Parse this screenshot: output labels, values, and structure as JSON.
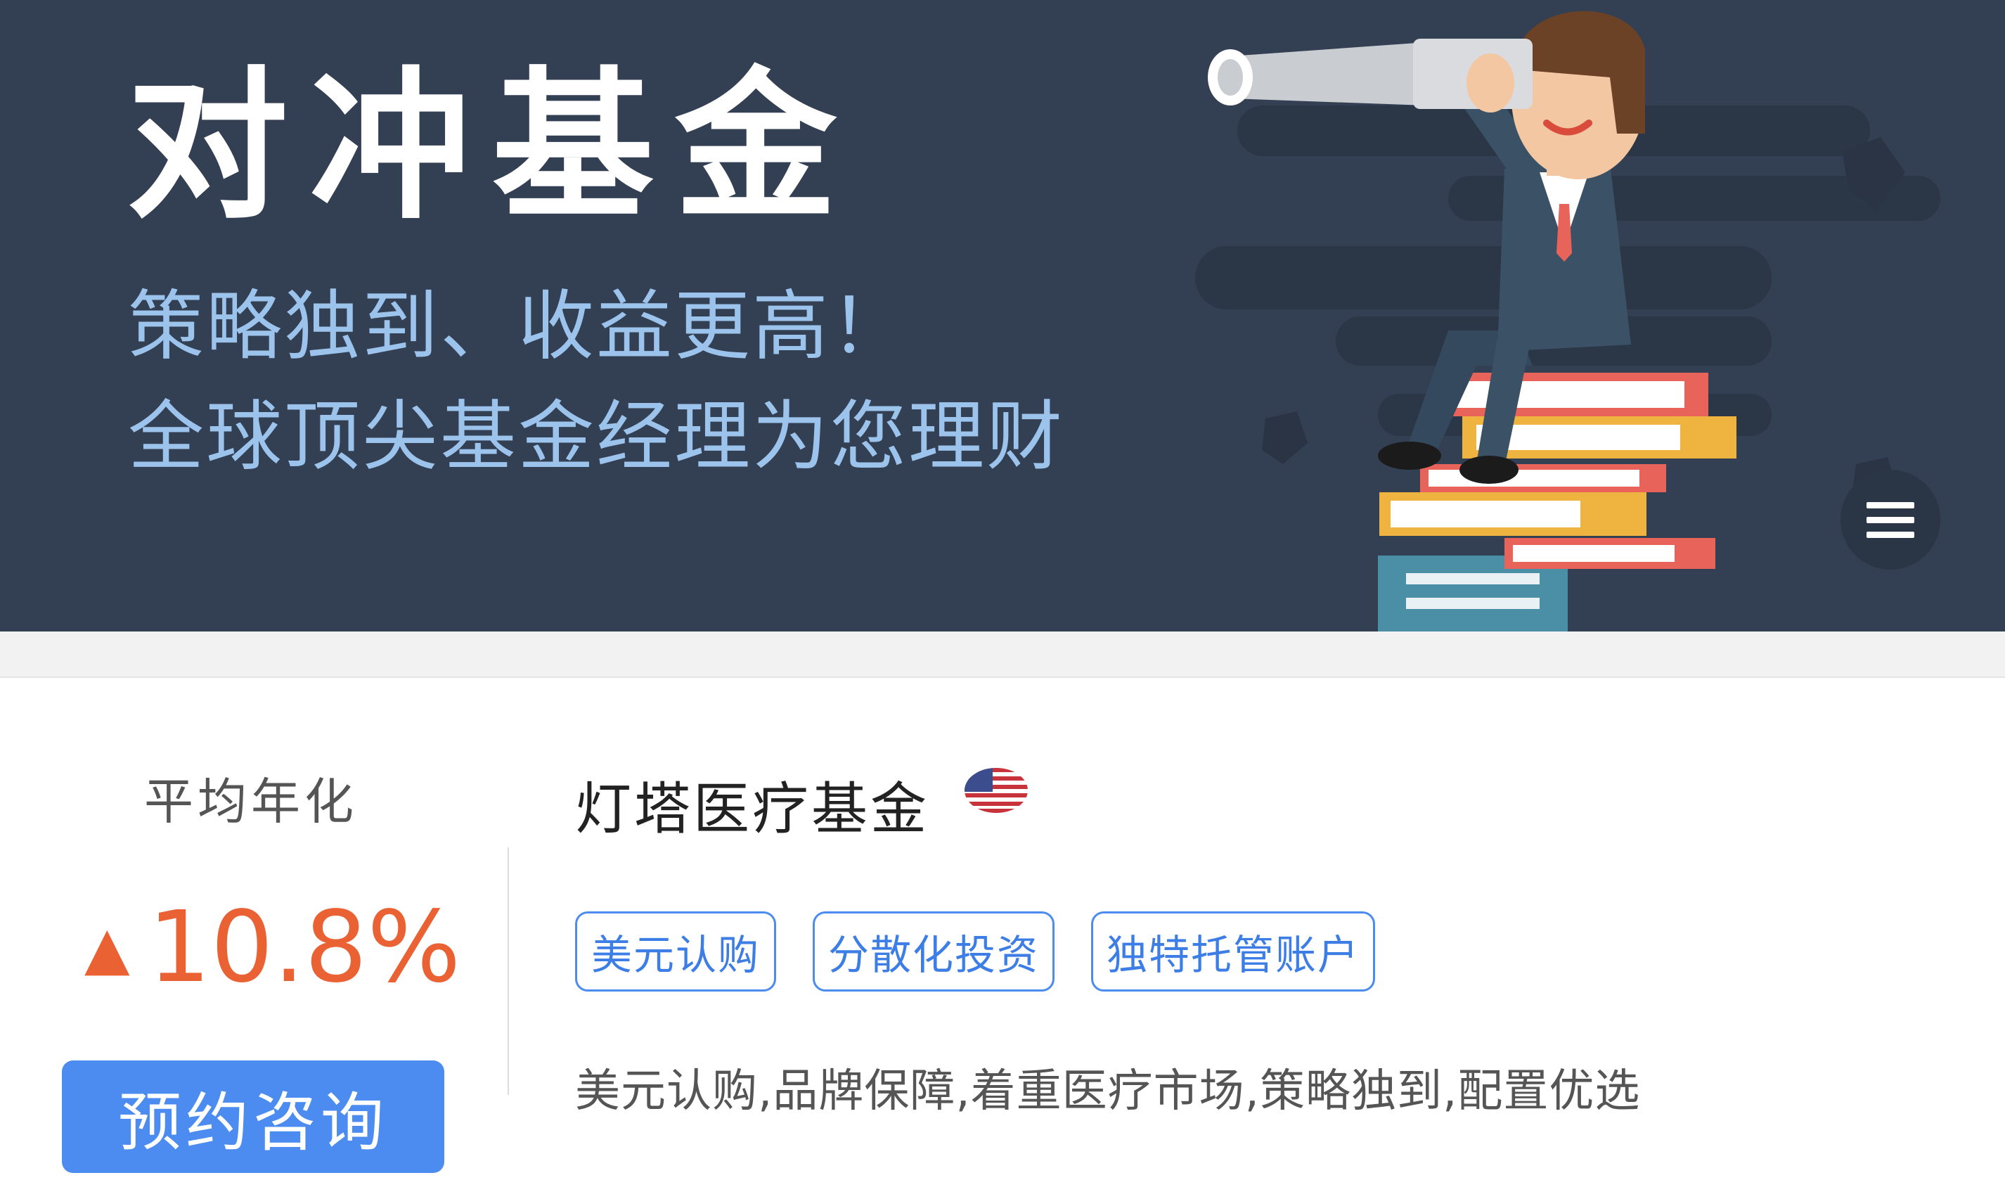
{
  "banner": {
    "title": "对冲基金",
    "line1": "策略独到、收益更高！",
    "line2": "全球顶尖基金经理为您理财"
  },
  "menu": {
    "icon": "hamburger-menu-icon"
  },
  "fund": {
    "yield_label": "平均年化",
    "yield_arrow": "▲",
    "yield_value": "10.8%",
    "consult_label": "预约咨询",
    "name": "灯塔医疗基金",
    "flag_icon": "us-flag-icon",
    "tags": [
      "美元认购",
      "分散化投资",
      "独特托管账户"
    ],
    "description": "美元认购,品牌保障,着重医疗市场,策略独到,配置优选"
  },
  "colors": {
    "banner_bg": "#333f52",
    "accent_blue": "#4c8cf0",
    "yield_orange": "#ea6233"
  }
}
